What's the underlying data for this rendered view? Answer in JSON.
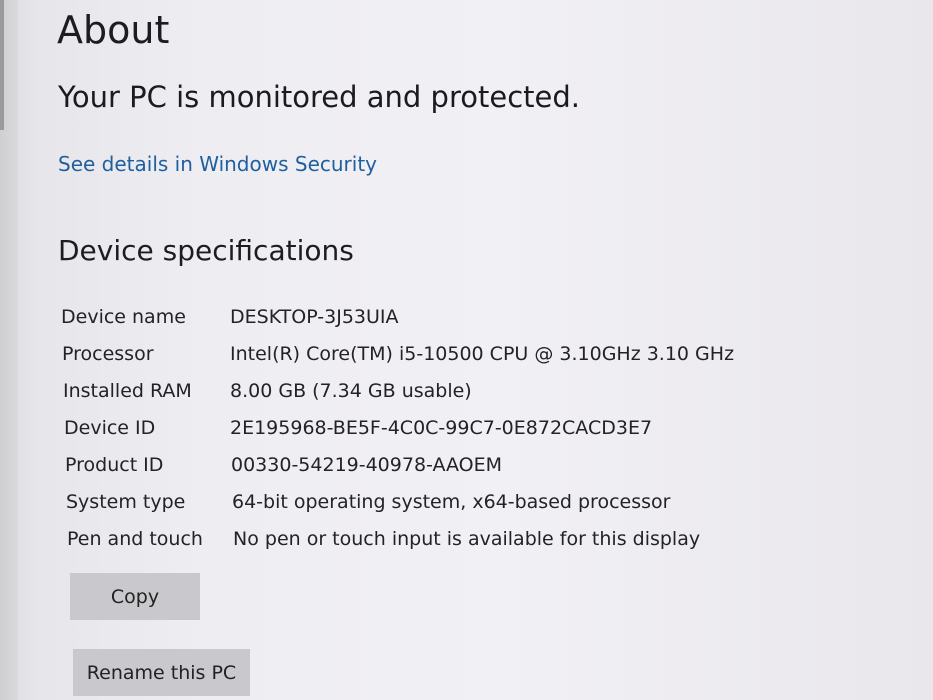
{
  "about": {
    "title": "About",
    "security_status": "Your PC is monitored and protected.",
    "security_link": "See details in Windows Security"
  },
  "specs": {
    "section_title": "Device specifications",
    "rows": [
      {
        "label": "Device name",
        "value": "DESKTOP-3J53UIA"
      },
      {
        "label": "Processor",
        "value": "Intel(R) Core(TM) i5-10500 CPU @ 3.10GHz   3.10 GHz"
      },
      {
        "label": "Installed RAM",
        "value": "8.00 GB (7.34 GB usable)"
      },
      {
        "label": "Device ID",
        "value": "2E195968-BE5F-4C0C-99C7-0E872CACD3E7"
      },
      {
        "label": "Product ID",
        "value": "00330-54219-40978-AAOEM"
      },
      {
        "label": "System type",
        "value": "64-bit operating system, x64-based processor"
      },
      {
        "label": "Pen and touch",
        "value": "No pen or touch input is available for this display"
      }
    ],
    "copy_label": "Copy"
  },
  "actions": {
    "rename_label": "Rename this PC"
  },
  "colors": {
    "link": "#1f5f9e",
    "button_bg": "#c9c8cd"
  }
}
